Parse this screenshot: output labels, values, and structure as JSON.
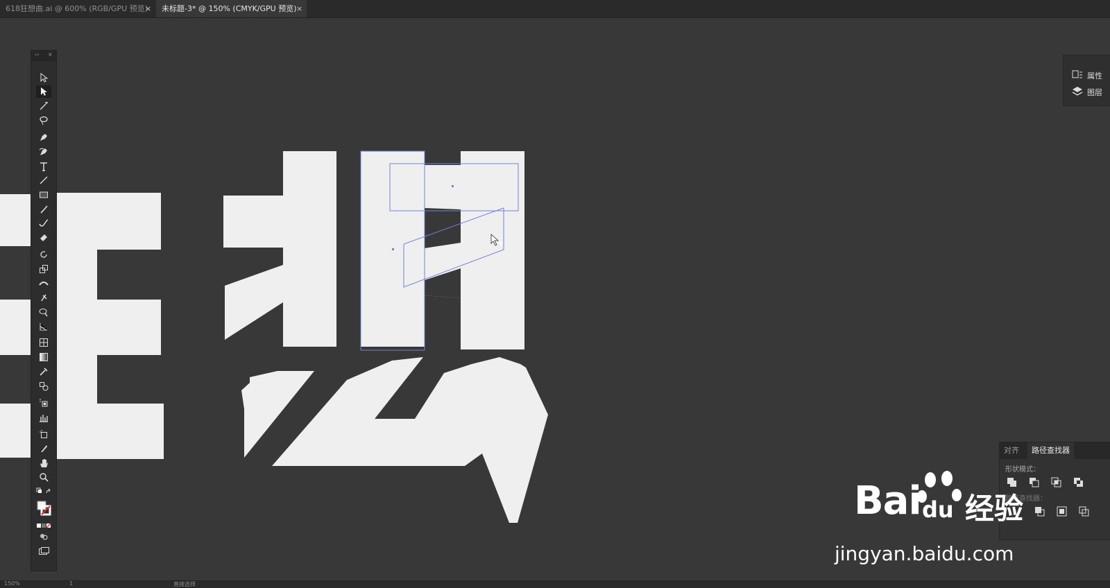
{
  "tabs": [
    {
      "label": "618狂想曲.ai @ 600% (RGB/GPU 预览)",
      "close": "×",
      "active": false
    },
    {
      "label": "未标题-3* @ 150% (CMYK/GPU 预览)",
      "close": "×",
      "active": true
    }
  ],
  "toolbar": {
    "collapse": "››",
    "close": "×",
    "tools": [
      "selection-tool",
      "direct-selection-tool",
      "magic-wand-tool",
      "lasso-tool",
      "pen-tool",
      "curvature-tool",
      "type-tool",
      "line-segment-tool",
      "rectangle-tool",
      "paintbrush-tool",
      "shaper-tool",
      "eraser-tool",
      "rotate-tool",
      "scale-tool",
      "width-tool",
      "puppet-warp-tool",
      "shape-builder-tool",
      "perspective-grid-tool",
      "mesh-tool",
      "gradient-tool",
      "eyedropper-tool",
      "blend-tool",
      "symbol-sprayer-tool",
      "column-graph-tool",
      "artboard-tool",
      "slice-tool",
      "hand-tool",
      "zoom-tool"
    ],
    "selected_tool": "direct-selection-tool"
  },
  "right_panel": {
    "items": [
      {
        "label": "属性",
        "icon": "properties-icon"
      },
      {
        "label": "图层",
        "icon": "layers-icon"
      }
    ]
  },
  "pathfinder": {
    "tabs": [
      "对齐",
      "路径查找器"
    ],
    "active_tab": "路径查找器",
    "shape_modes_label": "形状模式：",
    "pathfinders_label": "路径查找器："
  },
  "watermark": {
    "brand": "Bai",
    "brand_suffix": "du",
    "product": "经验",
    "url": "jingyan.baidu.com"
  },
  "status": {
    "zoom": "150%",
    "artboard": "1",
    "tool_name": "直接选择"
  },
  "colors": {
    "canvas": "#383838",
    "artwork": "#efefef",
    "selection": "#6f86d6",
    "ui_dark": "#2d2d2d"
  }
}
